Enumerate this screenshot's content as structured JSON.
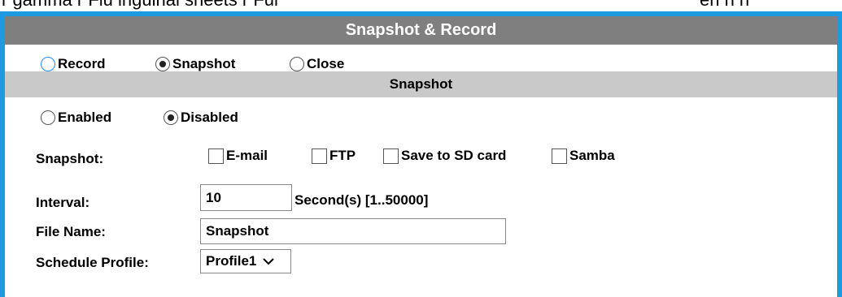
{
  "top_text": {
    "left": "r gamma r Flu inguinal sheets r Ful",
    "right": "en n n"
  },
  "title": "Snapshot & Record",
  "mode_options": [
    {
      "label": "Record",
      "checked": false
    },
    {
      "label": "Snapshot",
      "checked": true
    },
    {
      "label": "Close",
      "checked": false
    }
  ],
  "snapshot_section": {
    "header": "Snapshot",
    "enable_options": [
      {
        "label": "Enabled",
        "checked": false
      },
      {
        "label": "Disabled",
        "checked": true
      }
    ],
    "snapshot_label": "Snapshot:",
    "targets": [
      {
        "label": "E-mail",
        "checked": false
      },
      {
        "label": "FTP",
        "checked": false
      },
      {
        "label": "Save to SD card",
        "checked": false
      },
      {
        "label": "Samba",
        "checked": false
      }
    ],
    "interval_label": "Interval:",
    "interval_value": "10",
    "interval_unit": "Second(s) [1..50000]",
    "file_name_label": "File Name:",
    "file_name_value": "Snapshot",
    "schedule_label": "Schedule Profile:",
    "schedule_value": "Profile1"
  },
  "colors": {
    "frame": "#1e9be0",
    "main_header": "#7f7f7f",
    "sub_header": "#c9c9c9"
  }
}
